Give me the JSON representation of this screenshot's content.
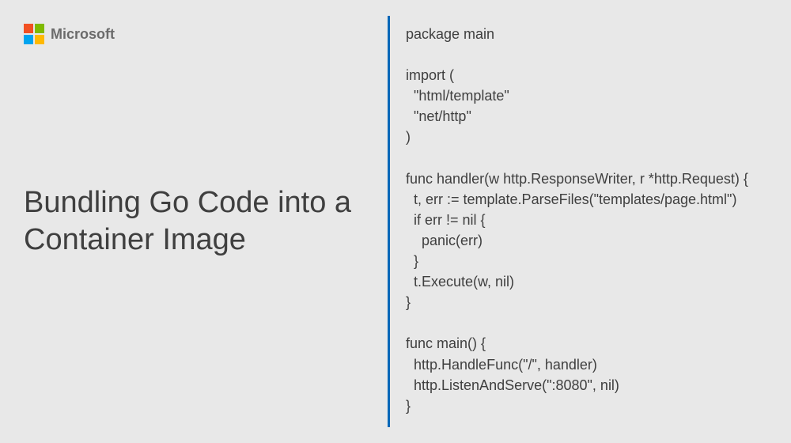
{
  "brand": {
    "name": "Microsoft",
    "logo_colors": [
      "#f25022",
      "#7fba00",
      "#00a4ef",
      "#ffb900"
    ]
  },
  "title": "Bundling Go Code\ninto a Container Image",
  "divider_color": "#0067b8",
  "code": "package main\n\nimport (\n  \"html/template\"\n  \"net/http\"\n)\n\nfunc handler(w http.ResponseWriter, r *http.Request) {\n  t, err := template.ParseFiles(\"templates/page.html\")\n  if err != nil {\n    panic(err)\n  }\n  t.Execute(w, nil)\n}\n\nfunc main() {\n  http.HandleFunc(\"/\", handler)\n  http.ListenAndServe(\":8080\", nil)\n}"
}
